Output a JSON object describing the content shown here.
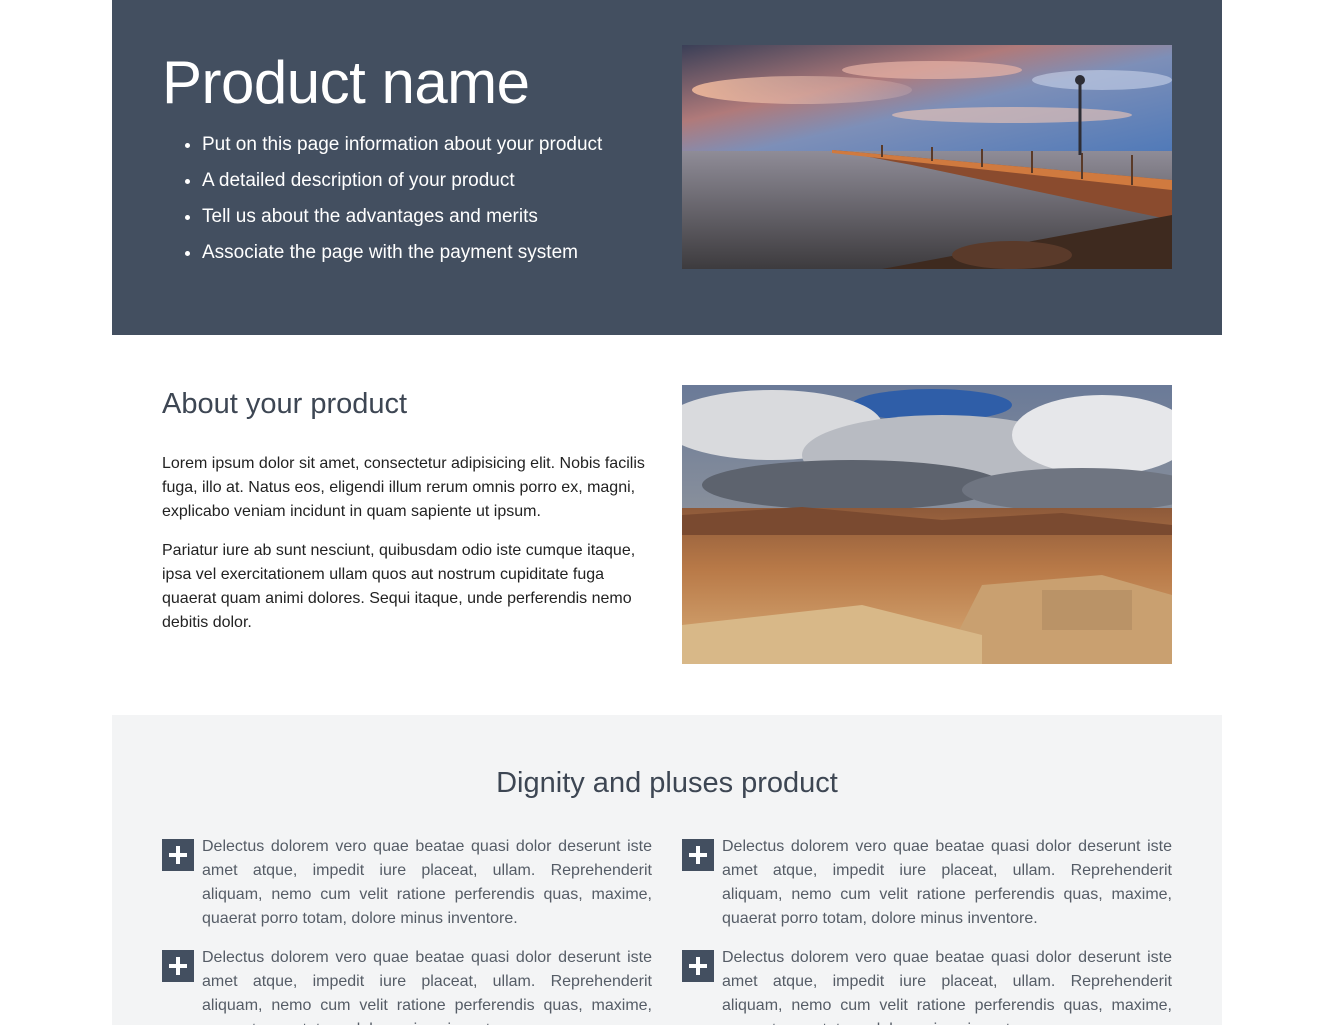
{
  "hero": {
    "title": "Product name",
    "bullets": [
      "Put on this page information about your product",
      "A detailed description of your product",
      "Tell us about the advantages and merits",
      "Associate the page with the payment system"
    ],
    "image_icon": "pier-sunset-photo"
  },
  "about": {
    "title": "About your product",
    "paragraphs": [
      "Lorem ipsum dolor sit amet, consectetur adipisicing elit. Nobis facilis fuga, illo at. Natus eos, eligendi illum rerum omnis porro ex, magni, explicabo veniam incidunt in quam sapiente ut ipsum.",
      "Pariatur iure ab sunt nesciunt, quibusdam odio iste cumque itaque, ipsa vel exercitationem ullam quos aut nostrum cupiditate fuga quaerat quam animi dolores. Sequi itaque, unde perferendis nemo debitis dolor."
    ],
    "image_icon": "desert-clouds-photo"
  },
  "dignity": {
    "title": "Dignity and pluses product",
    "features": [
      {
        "icon": "plus-icon",
        "text": "Delectus dolorem vero quae beatae quasi dolor deserunt iste amet atque, impedit iure placeat, ullam. Reprehenderit aliquam, nemo cum velit ratione perferendis quas, maxime, quaerat porro totam, dolore minus inventore."
      },
      {
        "icon": "plus-icon",
        "text": "Delectus dolorem vero quae beatae quasi dolor deserunt iste amet atque, impedit iure placeat, ullam. Reprehenderit aliquam, nemo cum velit ratione perferendis quas, maxime, quaerat porro totam, dolore minus inventore."
      },
      {
        "icon": "plus-icon",
        "text": "Delectus dolorem vero quae beatae quasi dolor deserunt iste amet atque, impedit iure placeat, ullam. Reprehenderit aliquam, nemo cum velit ratione perferendis quas, maxime, quaerat porro totam, dolore minus inventore."
      },
      {
        "icon": "plus-icon",
        "text": "Delectus dolorem vero quae beatae quasi dolor deserunt iste amet atque, impedit iure placeat, ullam. Reprehenderit aliquam, nemo cum velit ratione perferendis quas, maxime, quaerat porro totam, dolore minus inventore."
      }
    ]
  },
  "colors": {
    "hero_bg": "#434f60",
    "section_bg": "#f3f4f5",
    "heading": "#3d4653",
    "icon_bg": "#434f60"
  }
}
